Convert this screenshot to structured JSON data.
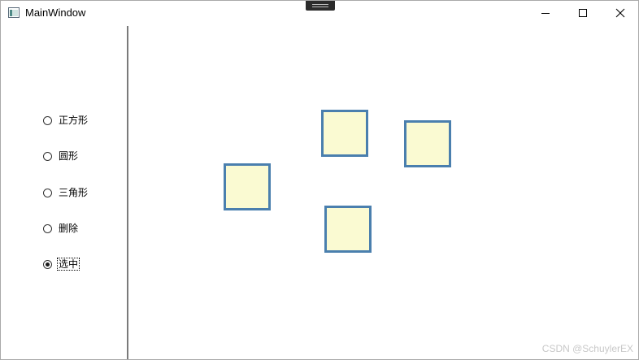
{
  "window": {
    "title": "MainWindow",
    "icon": "app-window-icon",
    "controls": [
      "minimize-icon",
      "maximize-icon",
      "close-icon"
    ]
  },
  "sidebar": {
    "options": [
      {
        "label": "正方形",
        "checked": false
      },
      {
        "label": "圆形",
        "checked": false
      },
      {
        "label": "三角形",
        "checked": false
      },
      {
        "label": "删除",
        "checked": false
      },
      {
        "label": "选中",
        "checked": true
      }
    ]
  },
  "canvas": {
    "shape_type": "square",
    "fill_color": "#fafad2",
    "stroke_color": "#4a7fae",
    "shape_count": 4
  },
  "watermark": "CSDN @SchuylerEX"
}
